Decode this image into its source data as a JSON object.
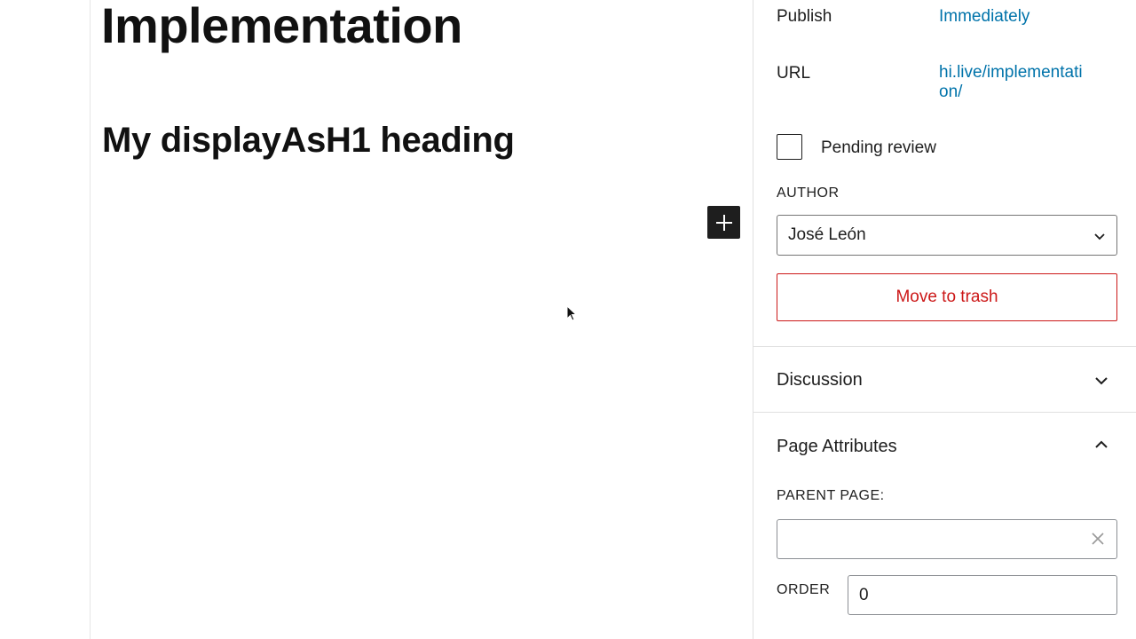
{
  "editor": {
    "title": "Implementation",
    "heading_block": "My displayAsH1 heading"
  },
  "sidebar": {
    "publish": {
      "label": "Publish",
      "value": "Immediately"
    },
    "url": {
      "label": "URL",
      "value_line1": "hi.live/implementati",
      "value_line2": "on/"
    },
    "pending_review": {
      "label": "Pending review",
      "checked": false
    },
    "author": {
      "label": "AUTHOR",
      "selected": "José León"
    },
    "trash_button": "Move to trash",
    "discussion_panel": {
      "title": "Discussion",
      "expanded": false
    },
    "page_attributes_panel": {
      "title": "Page Attributes",
      "expanded": true,
      "parent_page_label": "PARENT PAGE:",
      "parent_page_value": "",
      "order_label": "ORDER",
      "order_value": "0"
    }
  },
  "colors": {
    "link": "#0073aa",
    "danger": "#cc1818",
    "inserter_bg": "#1e1e1e"
  }
}
